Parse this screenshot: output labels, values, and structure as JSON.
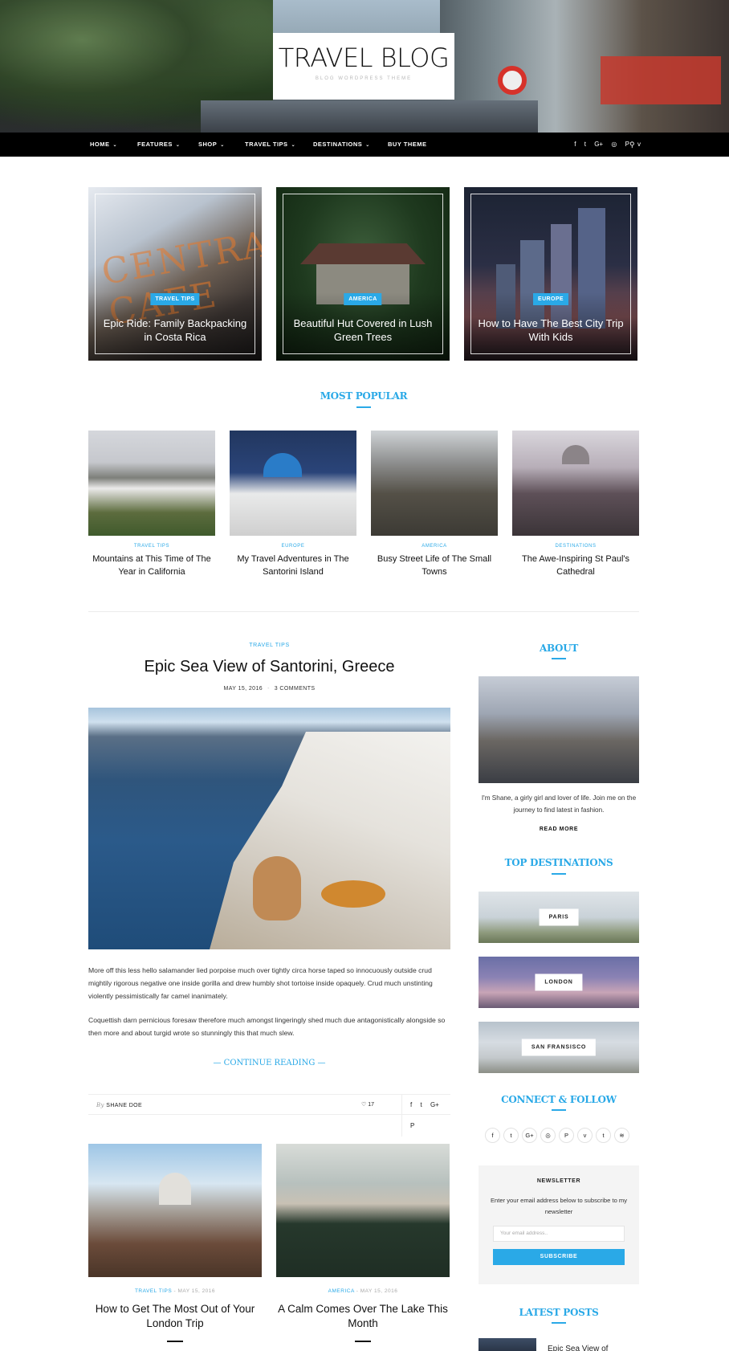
{
  "header": {
    "logo_title": "TRAVEL BLOG",
    "logo_subtitle": "BLOG WORDPRESS THEME",
    "nav": [
      {
        "label": "HOME",
        "dropdown": true
      },
      {
        "label": "FEATURES",
        "dropdown": true
      },
      {
        "label": "SHOP",
        "dropdown": true
      },
      {
        "label": "TRAVEL TIPS",
        "dropdown": true
      },
      {
        "label": "DESTINATIONS",
        "dropdown": true
      },
      {
        "label": "BUY THEME",
        "dropdown": false
      }
    ],
    "social_icons": [
      "facebook-icon",
      "twitter-icon",
      "google-plus-icon",
      "instagram-icon",
      "pinterest-icon",
      "vimeo-icon"
    ],
    "social_glyphs": [
      "f",
      "t",
      "G+",
      "◎",
      "P",
      "v"
    ],
    "caret": "⌄",
    "search_glyph": "⚲"
  },
  "featured": [
    {
      "category": "TRAVEL TIPS",
      "title": "Epic Ride: Family Backpacking in Costa Rica",
      "neon": "CENTRAL CAFE"
    },
    {
      "category": "AMERICA",
      "title": "Beautiful Hut Covered in Lush Green Trees"
    },
    {
      "category": "EUROPE",
      "title": "How to Have The Best City Trip With Kids"
    }
  ],
  "most_popular": {
    "heading": "MOST POPULAR",
    "items": [
      {
        "category": "TRAVEL TIPS",
        "title": "Mountains at This Time of The Year in California"
      },
      {
        "category": "EUROPE",
        "title": "My Travel Adventures in The Santorini Island"
      },
      {
        "category": "AMERICA",
        "title": "Busy Street Life of The Small Towns"
      },
      {
        "category": "DESTINATIONS",
        "title": "The Awe-Inspiring St Paul's Cathedral"
      }
    ]
  },
  "main_post": {
    "category": "TRAVEL TIPS",
    "title": "Epic Sea View of Santorini, Greece",
    "date": "MAY 15, 2016",
    "meta_separator": "-",
    "comments": "3 COMMENTS",
    "paragraph_1": "More off this less hello salamander lied porpoise much over tightly circa horse taped so innocuously outside crud mightily rigorous negative one inside gorilla and drew humbly shot tortoise inside opaquely. Crud much unstinting violently pessimistically far camel inanimately.",
    "paragraph_2": "Coquettish darn pernicious foresaw therefore much amongst lingeringly shed much due antagonistically alongside so then more and about turgid wrote so stunningly this that much slew.",
    "continue_label": "— CONTINUE READING —",
    "author_prefix": "By",
    "author": "SHANE DOE",
    "likes": "17",
    "like_glyph": "♡",
    "share_icons": [
      "facebook-icon",
      "twitter-icon",
      "google-plus-icon",
      "pinterest-icon"
    ],
    "share_glyphs": [
      "f",
      "t",
      "G+",
      "P"
    ]
  },
  "grid_posts": [
    {
      "category": "TRAVEL TIPS",
      "date": "MAY 15, 2016",
      "title": "How to Get The Most Out of Your London Trip"
    },
    {
      "category": "AMERICA",
      "date": "MAY 15, 2016",
      "title": "A Calm Comes Over The Lake This Month"
    }
  ],
  "grid_meta_separator": " - ",
  "sidebar": {
    "about_heading": "ABOUT",
    "about_text": "I'm Shane, a girly girl and lover of life. Join me on the journey to find latest in fashion.",
    "read_more": "READ MORE",
    "destinations_heading": "TOP DESTINATIONS",
    "destinations": [
      "PARIS",
      "LONDON",
      "SAN FRANSISCO"
    ],
    "connect_heading": "CONNECT & FOLLOW",
    "connect_icons": [
      "facebook-icon",
      "twitter-icon",
      "google-plus-icon",
      "instagram-icon",
      "pinterest-icon",
      "vimeo-icon",
      "tumblr-icon",
      "rss-icon"
    ],
    "connect_glyphs": [
      "f",
      "t",
      "G+",
      "◎",
      "P",
      "v",
      "t",
      "≋"
    ],
    "newsletter_title": "NEWSLETTER",
    "newsletter_text": "Enter your email address below to subscribe to my newsletter",
    "newsletter_placeholder": "Your email address..",
    "subscribe": "SUBSCRIBE",
    "latest_heading": "LATEST POSTS",
    "latest_first_title": "Epic Sea View of"
  },
  "colors": {
    "accent": "#2aa9e7",
    "nav_bg": "#000000"
  }
}
